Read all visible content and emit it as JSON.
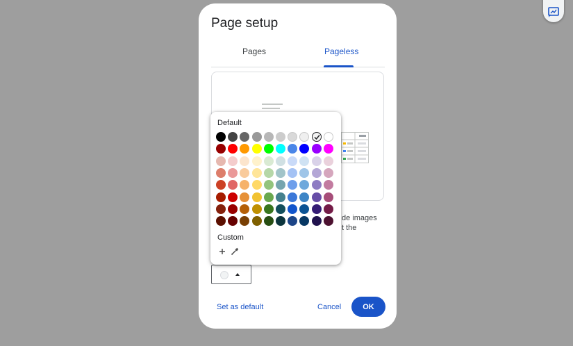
{
  "dialog": {
    "title": "Page setup",
    "tabs": [
      {
        "label": "Pages"
      },
      {
        "label": "Pageless"
      }
    ],
    "description": "de images\nt the",
    "set_default_label": "Set as default",
    "cancel_label": "Cancel",
    "ok_label": "OK"
  },
  "picker": {
    "default_label": "Default",
    "custom_label": "Custom",
    "selected": "#f3f3f3",
    "rows": [
      [
        "#000000",
        "#434343",
        "#666666",
        "#999999",
        "#b7b7b7",
        "#cccccc",
        "#d9d9d9",
        "#efefef",
        "#f3f3f3",
        "#ffffff"
      ],
      [
        "#980000",
        "#ff0000",
        "#ff9900",
        "#ffff00",
        "#00ff00",
        "#00ffff",
        "#4a86e8",
        "#0000ff",
        "#9900ff",
        "#ff00ff"
      ],
      [
        "#e6b8af",
        "#f4cccc",
        "#fce5cd",
        "#fff2cc",
        "#d9ead3",
        "#d0e0e3",
        "#c9daf8",
        "#cfe2f3",
        "#d9d2e9",
        "#ead1dc"
      ],
      [
        "#dd7e6b",
        "#ea9999",
        "#f9cb9c",
        "#ffe599",
        "#b6d7a8",
        "#a2c4c9",
        "#a4c2f4",
        "#9fc5e8",
        "#b4a7d6",
        "#d5a6bd"
      ],
      [
        "#cc4125",
        "#e06666",
        "#f6b26b",
        "#ffd966",
        "#93c47d",
        "#76a5af",
        "#6d9eeb",
        "#6fa8dc",
        "#8e7cc3",
        "#c27ba0"
      ],
      [
        "#a61c00",
        "#cc0000",
        "#e69138",
        "#f1c232",
        "#6aa84f",
        "#45818e",
        "#3c78d8",
        "#3d85c6",
        "#674ea7",
        "#a64d79"
      ],
      [
        "#85200c",
        "#990000",
        "#b45f06",
        "#bf9000",
        "#38761d",
        "#134f5c",
        "#1155cc",
        "#0b5394",
        "#351c75",
        "#741b47"
      ],
      [
        "#5b0f00",
        "#660000",
        "#783f04",
        "#7f6000",
        "#274e13",
        "#0c343d",
        "#1c4587",
        "#073763",
        "#20124d",
        "#4c1130"
      ]
    ]
  }
}
